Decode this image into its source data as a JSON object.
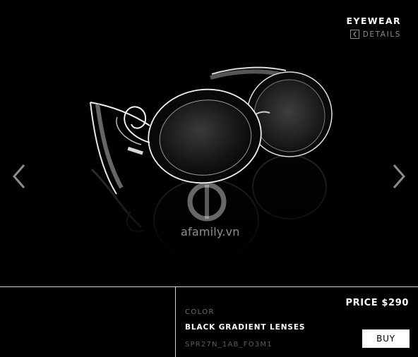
{
  "header": {
    "category": "EYEWEAR",
    "details_label": "DETAILS",
    "details_icon": "chevron-left-icon"
  },
  "gallery": {
    "prev_icon": "chevron-left-icon",
    "next_icon": "chevron-right-icon",
    "watermark": "afamily.vn"
  },
  "product": {
    "color_label": "COLOR",
    "color_value": "BLACK GRADIENT LENSES",
    "sku": "SPR27N_1AB_FO3M1",
    "price": "PRICE $290",
    "buy_label": "BUY"
  }
}
